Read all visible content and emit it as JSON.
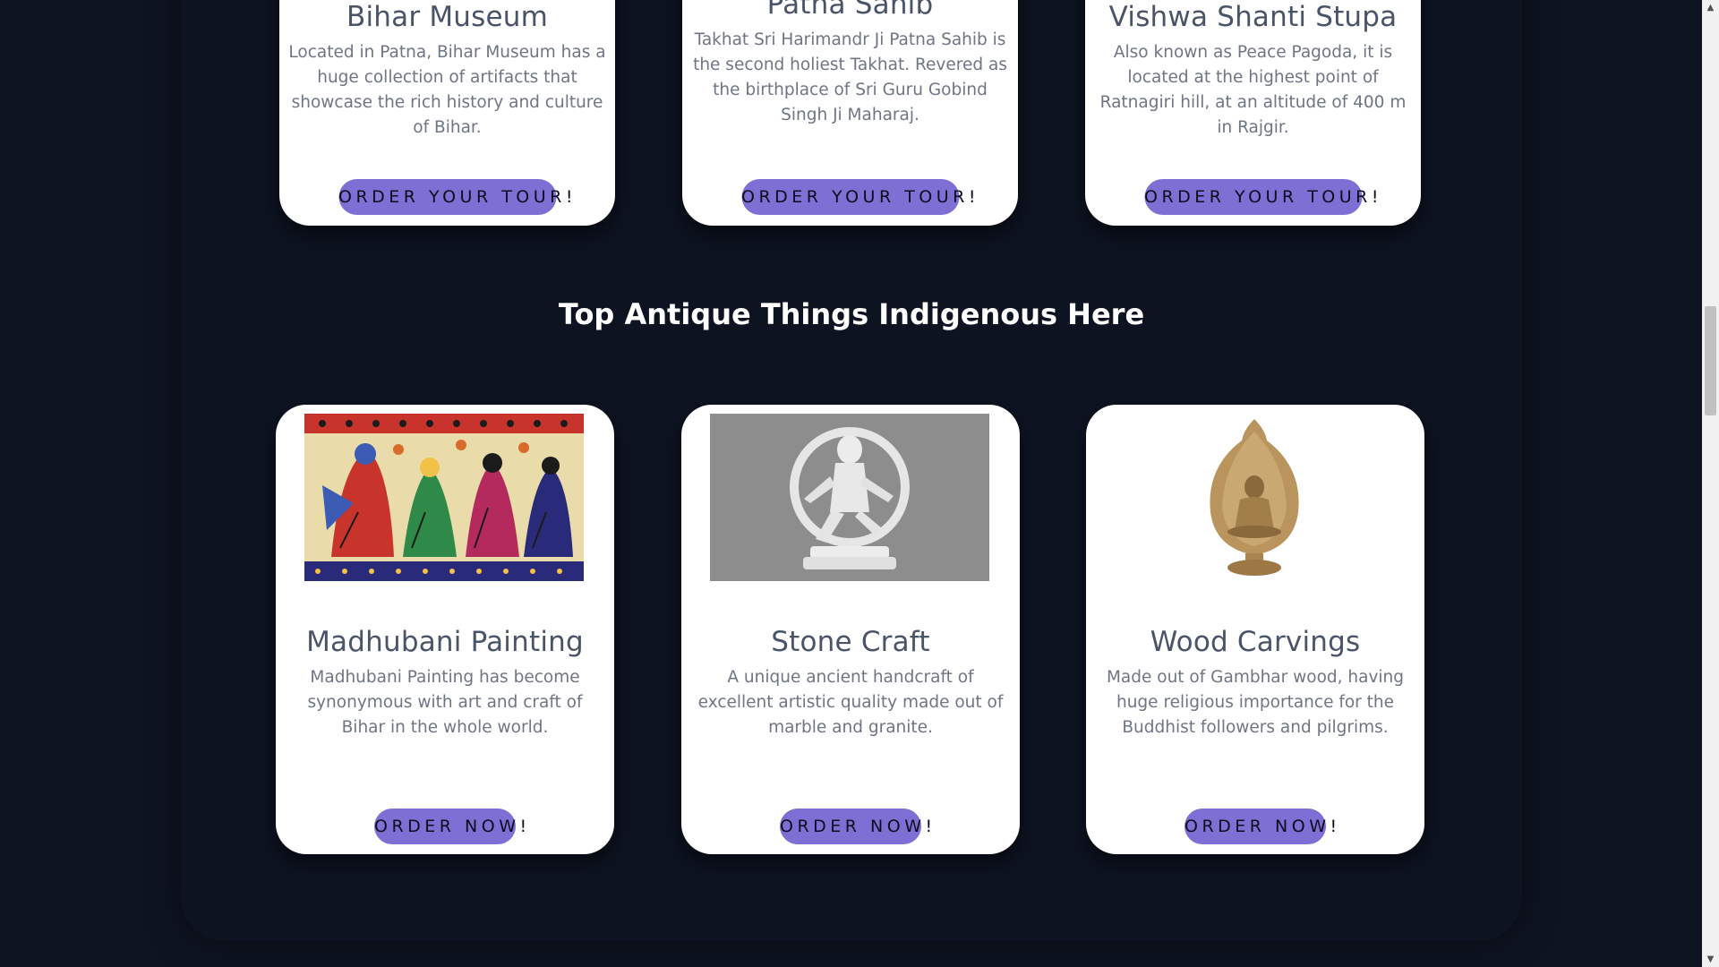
{
  "places": [
    {
      "title": "Bihar Museum",
      "description": "Located in Patna, Bihar Museum has a huge collection of artifacts that showcase the rich history and culture of Bihar.",
      "button": "ORDER YOUR TOUR!"
    },
    {
      "title": "Patna Sahib",
      "description": "Takhat Sri Harimandr Ji Patna Sahib is the second holiest Takhat. Revered as the birthplace of Sri Guru Gobind Singh Ji Maharaj.",
      "button": "ORDER YOUR TOUR!"
    },
    {
      "title": "Vishwa Shanti Stupa",
      "description": "Also known as Peace Pagoda, it is located at the highest point of Ratnagiri hill, at an altitude of 400 m in Rajgir.",
      "button": "ORDER YOUR TOUR!"
    }
  ],
  "antique_section": {
    "heading": "Top Antique Things Indigenous Here"
  },
  "antiques": [
    {
      "title": "Madhubani Painting",
      "description": "Madhubani Painting has become synonymous with art and craft of Bihar in the whole world.",
      "button": "ORDER NOW!"
    },
    {
      "title": "Stone Craft",
      "description": "A unique ancient handcraft of excellent artistic quality made out of marble and granite.",
      "button": "ORDER NOW!"
    },
    {
      "title": "Wood Carvings",
      "description": "Made out of Gambhar wood, having huge religious importance for the Buddhist followers and pilgrims.",
      "button": "ORDER NOW!"
    }
  ],
  "colors": {
    "background": "#0d1321",
    "card": "#ffffff",
    "button": "#7d6fd3",
    "heading": "#ffffff"
  }
}
